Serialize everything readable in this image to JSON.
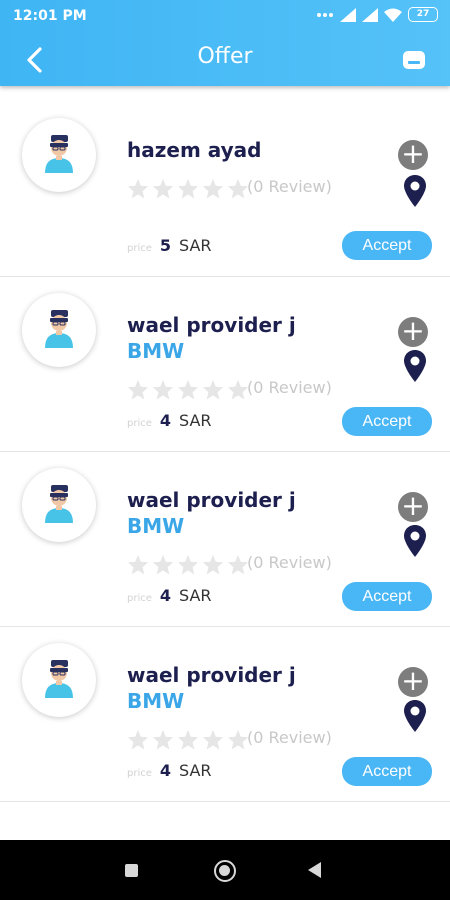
{
  "status": {
    "time": "12:01 PM",
    "battery": "27"
  },
  "header": {
    "title": "Offer"
  },
  "offers": [
    {
      "name": "hazem ayad",
      "car": "",
      "rating": 0,
      "review_text": "(0 Review)",
      "price_label": "price",
      "price": "5",
      "currency": "SAR",
      "accept_label": "Accept"
    },
    {
      "name": "wael provider j",
      "car": "BMW",
      "rating": 0,
      "review_text": "(0 Review)",
      "price_label": "price",
      "price": "4",
      "currency": "SAR",
      "accept_label": "Accept"
    },
    {
      "name": "wael provider j",
      "car": "BMW",
      "rating": 0,
      "review_text": "(0 Review)",
      "price_label": "price",
      "price": "4",
      "currency": "SAR",
      "accept_label": "Accept"
    },
    {
      "name": "wael provider j",
      "car": "BMW",
      "rating": 0,
      "review_text": "(0 Review)",
      "price_label": "price",
      "price": "4",
      "currency": "SAR",
      "accept_label": "Accept"
    }
  ],
  "icons": {
    "back": "chevron-left-icon",
    "chat": "chat-icon",
    "add": "plus-icon",
    "location": "map-pin-icon",
    "avatar": "user-avatar-icon",
    "star": "star-icon"
  },
  "colors": {
    "header": "#3fb5f4",
    "accent": "#49b6f5",
    "name": "#1d1f4f",
    "car": "#3aa6e7",
    "pin": "#1d1f4f",
    "star_empty": "#e6e6e6"
  }
}
